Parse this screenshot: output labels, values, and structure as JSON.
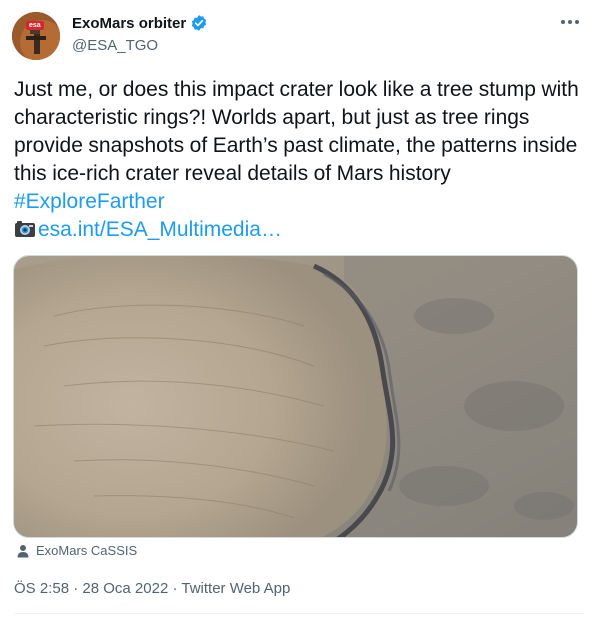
{
  "author": {
    "display_name": "ExoMars orbiter",
    "handle": "@ESA_TGO",
    "avatar_badge": "esa",
    "verified_color": "#1d9bf0"
  },
  "tweet": {
    "text": "Just me, or does this impact crater look like a tree stump with characteristic rings?! Worlds apart, but just as tree rings provide snapshots of Earth’s past climate, the patterns inside this ice-rich crater reveal details of Mars history ",
    "hashtag": "#ExploreFarther",
    "link_text": "esa.int/ESA_Multimedia…",
    "camera_icon": "camera-icon"
  },
  "media": {
    "subject": "crater-image",
    "tagged_user": "ExoMars CaSSIS"
  },
  "meta": {
    "time": "ÖS 2:58",
    "separator": " · ",
    "date": "28 Oca 2022",
    "source": "Twitter Web App"
  },
  "colors": {
    "link": "#1d9bf0",
    "secondary_text": "#536471",
    "primary_text": "#0f1419",
    "esa_red": "#d7262e"
  }
}
